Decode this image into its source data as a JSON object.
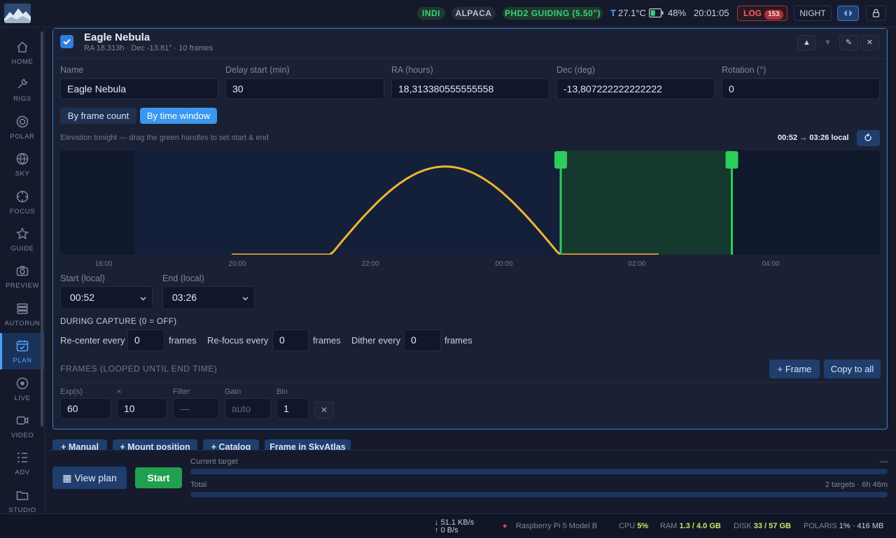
{
  "topbar": {
    "pills": {
      "indi": "INDI",
      "alpaca": "ALPACA",
      "phd2": "PHD2 GUIDING (5.50\")"
    },
    "temperature": "27.1°C",
    "battery": "48%",
    "battery_level": 0.48,
    "clock": "20:01:05",
    "log_label": "LOG",
    "log_count": "153",
    "night_label": "NIGHT"
  },
  "sidebar": {
    "items": [
      {
        "label": "HOME",
        "icon": "home-icon"
      },
      {
        "label": "RIGS",
        "icon": "wrench-icon"
      },
      {
        "label": "POLAR",
        "icon": "target-icon"
      },
      {
        "label": "SKY",
        "icon": "globe-icon"
      },
      {
        "label": "FOCUS",
        "icon": "focus-icon"
      },
      {
        "label": "GUIDE",
        "icon": "star-icon"
      },
      {
        "label": "PREVIEW",
        "icon": "camera-icon"
      },
      {
        "label": "AUTORUN",
        "icon": "stack-icon"
      },
      {
        "label": "PLAN",
        "icon": "calendar-icon",
        "active": true
      },
      {
        "label": "LIVE",
        "icon": "live-icon"
      },
      {
        "label": "VIDEO",
        "icon": "video-icon"
      },
      {
        "label": "ADV",
        "icon": "list-icon"
      },
      {
        "label": "STUDIO",
        "icon": "folder-icon"
      }
    ]
  },
  "target": {
    "title": "Eagle Nebula",
    "subtitle": "RA 18.313h · Dec -13.81° · 10 frames",
    "fields": {
      "name": {
        "label": "Name",
        "value": "Eagle Nebula"
      },
      "delay": {
        "label": "Delay start (min)",
        "value": "30"
      },
      "ra": {
        "label": "RA (hours)",
        "value": "18,313380555555558"
      },
      "dec": {
        "label": "Dec (deg)",
        "value": "-13,807222222222222"
      },
      "rotation": {
        "label": "Rotation (°)",
        "value": "0"
      }
    },
    "mode_tabs": {
      "by_count": "By frame count",
      "by_time": "By time window",
      "selected": "by_time"
    }
  },
  "elevation": {
    "hint": "Elevation tonight — drag the green handles to set start & end",
    "window_label": "00:52 → 03:26 local",
    "ticks": [
      "18:00",
      "20:00",
      "22:00",
      "00:00",
      "02:00",
      "04:00"
    ],
    "start_handle": "00:52",
    "end_handle": "03:26"
  },
  "window": {
    "start_label": "Start (local)",
    "start_value": "00:52",
    "end_label": "End (local)",
    "end_value": "03:26"
  },
  "capture": {
    "title": "DURING CAPTURE (0 = OFF)",
    "recenter_label": "Re-center every",
    "recenter_value": "0",
    "refocus_label": "Re-focus every",
    "refocus_value": "0",
    "dither_label": "Dither every",
    "dither_value": "0",
    "unit": "frames"
  },
  "frames": {
    "title": "FRAMES (LOOPED UNTIL END TIME)",
    "add_frame": "+ Frame",
    "copy_all": "Copy to all",
    "columns": {
      "exp": "Exp(s)",
      "count": "×",
      "filter": "Filter",
      "gain": "Gain",
      "bin": "Bin"
    },
    "row": {
      "exp": "60",
      "count": "10",
      "filter_placeholder": "—",
      "gain_placeholder": "auto",
      "bin": "1",
      "delete": "✕"
    }
  },
  "add_buttons": {
    "manual": "+ Manual",
    "mount": "+ Mount position",
    "catalog": "+ Catalog",
    "skyatlas": "Frame in SkyAtlas"
  },
  "bottom": {
    "view_plan": "View plan",
    "start": "Start",
    "current_label": "Current target",
    "current_value": "—",
    "current_progress": 0,
    "total_label": "Total",
    "total_value": "2 targets · 6h 46m",
    "total_progress": 0
  },
  "statusbar": {
    "down": "51.1 KB/s",
    "up": "0 B/s",
    "device": "Raspberry Pi 5 Model B",
    "cpu_label": "CPU",
    "cpu_value": "5%",
    "ram_label": "RAM",
    "ram_value": "1.3 / 4.0 GB",
    "disk_label": "DISK",
    "disk_value": "33 / 57 GB",
    "polaris_label": "POLARIS",
    "polaris_value": "1% · 416 MB"
  },
  "colors": {
    "accent": "#3b97ef",
    "ok": "#3fcf7a",
    "curve": "#f1b531",
    "handle": "#2ecc5b",
    "danger": "#ff5a64"
  }
}
